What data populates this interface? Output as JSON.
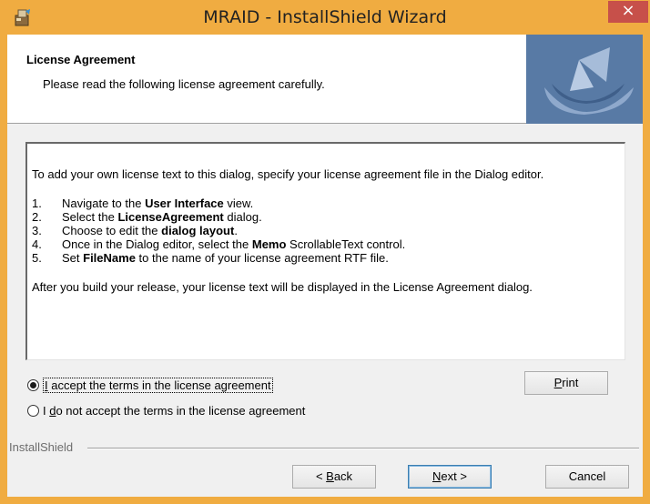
{
  "window": {
    "title": "MRAID - InstallShield Wizard",
    "close_glyph": "×",
    "accent_color": "#f0ac41",
    "close_color": "#c7504a"
  },
  "banner": {
    "title": "License Agreement",
    "subtitle": "Please read the following license agreement carefully."
  },
  "license": {
    "intro": "To add your own license text to this dialog, specify your license agreement file in the Dialog editor.",
    "steps": [
      {
        "num": "1.",
        "pre": "Navigate to the ",
        "bold": "User Interface",
        "post": " view."
      },
      {
        "num": "2.",
        "pre": "Select the ",
        "bold": "LicenseAgreement",
        "post": " dialog."
      },
      {
        "num": "3.",
        "pre": "Choose to edit the ",
        "bold": "dialog layout",
        "post": "."
      },
      {
        "num": "4.",
        "pre": "Once in the Dialog editor, select the ",
        "bold": "Memo",
        "post": " ScrollableText control."
      },
      {
        "num": "5.",
        "pre": "Set ",
        "bold": "FileName",
        "post": " to the name of your license agreement RTF file."
      }
    ],
    "outro": "After you build your release, your license text will be displayed in the License Agreement dialog."
  },
  "options": {
    "accept": {
      "mnemonic": "I",
      "rest": " accept the terms in the license agreement",
      "selected": true
    },
    "decline": {
      "pre": "I ",
      "mnemonic": "d",
      "rest": "o not accept the terms in the license agreement",
      "selected": false
    }
  },
  "buttons": {
    "print": {
      "mnemonic": "P",
      "rest": "rint"
    },
    "back": {
      "pre": "< ",
      "mnemonic": "B",
      "rest": "ack"
    },
    "next": {
      "mnemonic": "N",
      "rest": "ext >"
    },
    "cancel": "Cancel"
  },
  "footer": {
    "brand": "InstallShield"
  }
}
